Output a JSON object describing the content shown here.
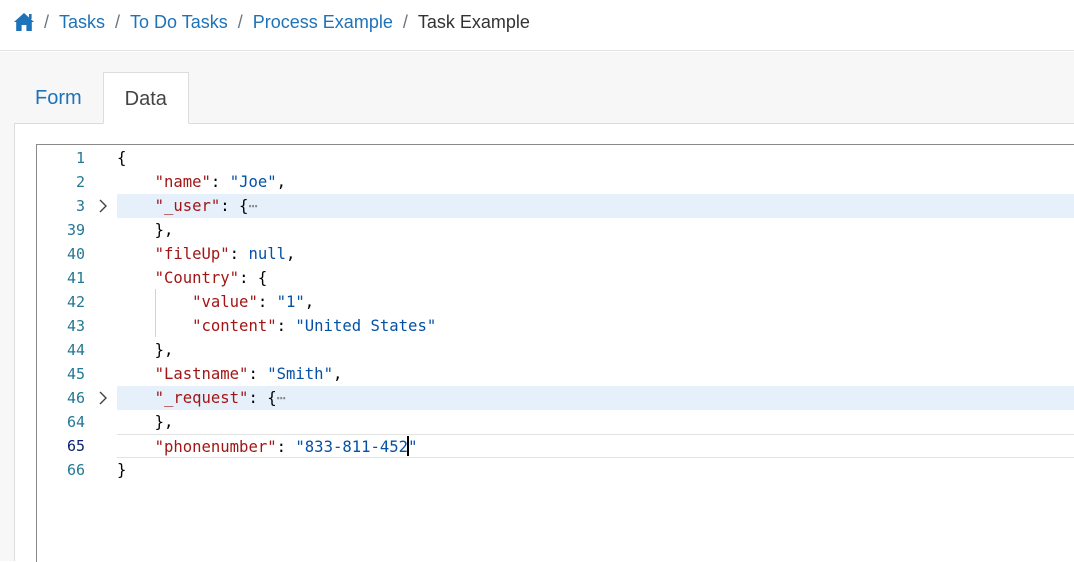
{
  "breadcrumb": {
    "home_icon": "home-icon",
    "separator": "/",
    "links": [
      "Tasks",
      "To Do Tasks",
      "Process Example"
    ],
    "current": "Task Example"
  },
  "tabs": [
    {
      "label": "Form",
      "active": false
    },
    {
      "label": "Data",
      "active": true
    }
  ],
  "editor": {
    "lines": [
      {
        "num": "1"
      },
      {
        "num": "2",
        "key": "\"name\"",
        "value": "\"Joe\""
      },
      {
        "num": "3",
        "key": "\"_user\"",
        "ellipsis": "⋯"
      },
      {
        "num": "39"
      },
      {
        "num": "40",
        "key": "\"fileUp\"",
        "value": "null"
      },
      {
        "num": "41",
        "key": "\"Country\""
      },
      {
        "num": "42",
        "key": "\"value\"",
        "value": "\"1\""
      },
      {
        "num": "43",
        "key": "\"content\"",
        "value": "\"United States\""
      },
      {
        "num": "44"
      },
      {
        "num": "45",
        "key": "\"Lastname\"",
        "value": "\"Smith\""
      },
      {
        "num": "46",
        "key": "\"_request\"",
        "ellipsis": "⋯"
      },
      {
        "num": "64"
      },
      {
        "num": "65",
        "key": "\"phonenumber\"",
        "value_before_caret": "\"833-811-452",
        "value_after_caret": "\""
      },
      {
        "num": "66"
      }
    ],
    "colors": {
      "key": "#a31515",
      "string": "#0451a5",
      "line_number": "#237893",
      "highlight": "#e5f0fb"
    }
  }
}
